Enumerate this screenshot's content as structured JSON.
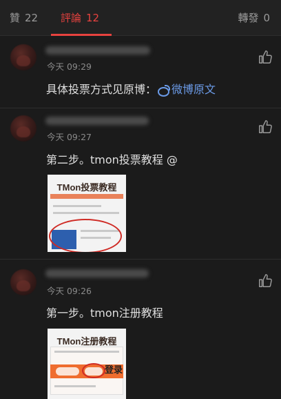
{
  "tabs": {
    "likes": {
      "label": "贊",
      "count": "22"
    },
    "comments": {
      "label": "評論",
      "count": "12"
    },
    "reposts": {
      "label": "轉發",
      "count": "0"
    }
  },
  "comments": [
    {
      "time": "今天 09:29",
      "text": "具体投票方式见原博：",
      "link_text": "微博原文"
    },
    {
      "time": "今天 09:27",
      "text": "第二步。tmon投票教程 @",
      "image_title": "TMon投票教程"
    },
    {
      "time": "今天 09:26",
      "text": "第一步。tmon注册教程",
      "image_title": "TMon注册教程",
      "image_button": "登录"
    }
  ],
  "colors": {
    "accent": "#e8423f",
    "link": "#6b9be8",
    "background": "#1b1b1b"
  },
  "icons": [
    "thumbs-up-icon",
    "weibo-icon"
  ]
}
